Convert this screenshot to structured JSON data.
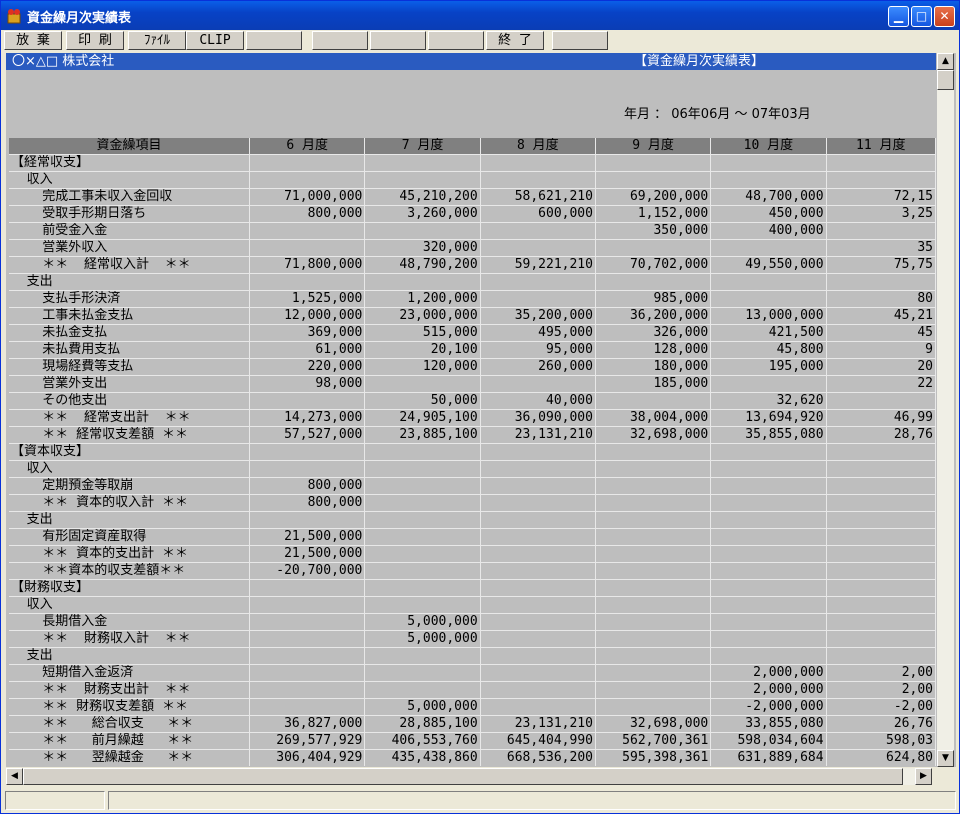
{
  "window": {
    "title": "資金繰月次実績表"
  },
  "toolbar": {
    "buttons": [
      "放 棄",
      "印 刷",
      "ﾌｧｲﾙ",
      "CLIP",
      "",
      "",
      "",
      "",
      "終 了",
      ""
    ]
  },
  "report": {
    "company": "〇×△□ 株式会社",
    "title": "【資金繰月次実績表】",
    "period": "年月 ： 06年06月 ～ 07年03月"
  },
  "table": {
    "columns": [
      "資金繰項目",
      "6 月度",
      "7 月度",
      "8 月度",
      "9 月度",
      "10 月度",
      "11 月度"
    ],
    "rows": [
      [
        "【経常収支】",
        "",
        "",
        "",
        "",
        "",
        ""
      ],
      [
        "  収入",
        "",
        "",
        "",
        "",
        "",
        ""
      ],
      [
        "    完成工事未収入金回収",
        "71,000,000",
        "45,210,200",
        "58,621,210",
        "69,200,000",
        "48,700,000",
        "72,15"
      ],
      [
        "    受取手形期日落ち",
        "800,000",
        "3,260,000",
        "600,000",
        "1,152,000",
        "450,000",
        "3,25"
      ],
      [
        "    前受金入金",
        "",
        "",
        "",
        "350,000",
        "400,000",
        ""
      ],
      [
        "    営業外収入",
        "",
        "320,000",
        "",
        "",
        "",
        "35"
      ],
      [
        "    ＊＊  経常収入計  ＊＊",
        "71,800,000",
        "48,790,200",
        "59,221,210",
        "70,702,000",
        "49,550,000",
        "75,75"
      ],
      [
        "  支出",
        "",
        "",
        "",
        "",
        "",
        ""
      ],
      [
        "    支払手形決済",
        "1,525,000",
        "1,200,000",
        "",
        "985,000",
        "",
        "80"
      ],
      [
        "    工事未払金支払",
        "12,000,000",
        "23,000,000",
        "35,200,000",
        "36,200,000",
        "13,000,000",
        "45,21"
      ],
      [
        "    未払金支払",
        "369,000",
        "515,000",
        "495,000",
        "326,000",
        "421,500",
        "45"
      ],
      [
        "    未払費用支払",
        "61,000",
        "20,100",
        "95,000",
        "128,000",
        "45,800",
        "9"
      ],
      [
        "    現場経費等支払",
        "220,000",
        "120,000",
        "260,000",
        "180,000",
        "195,000",
        "20"
      ],
      [
        "    営業外支出",
        "98,000",
        "",
        "",
        "185,000",
        "",
        "22"
      ],
      [
        "    その他支出",
        "",
        "50,000",
        "40,000",
        "",
        "32,620",
        ""
      ],
      [
        "    ＊＊  経常支出計  ＊＊",
        "14,273,000",
        "24,905,100",
        "36,090,000",
        "38,004,000",
        "13,694,920",
        "46,99"
      ],
      [
        "    ＊＊ 経常収支差額 ＊＊",
        "57,527,000",
        "23,885,100",
        "23,131,210",
        "32,698,000",
        "35,855,080",
        "28,76"
      ],
      [
        "【資本収支】",
        "",
        "",
        "",
        "",
        "",
        ""
      ],
      [
        "  収入",
        "",
        "",
        "",
        "",
        "",
        ""
      ],
      [
        "    定期預金等取崩",
        "800,000",
        "",
        "",
        "",
        "",
        ""
      ],
      [
        "    ＊＊ 資本的収入計 ＊＊",
        "800,000",
        "",
        "",
        "",
        "",
        ""
      ],
      [
        "  支出",
        "",
        "",
        "",
        "",
        "",
        ""
      ],
      [
        "    有形固定資産取得",
        "21,500,000",
        "",
        "",
        "",
        "",
        ""
      ],
      [
        "    ＊＊ 資本的支出計 ＊＊",
        "21,500,000",
        "",
        "",
        "",
        "",
        ""
      ],
      [
        "    ＊＊資本的収支差額＊＊",
        "-20,700,000",
        "",
        "",
        "",
        "",
        ""
      ],
      [
        "【財務収支】",
        "",
        "",
        "",
        "",
        "",
        ""
      ],
      [
        "  収入",
        "",
        "",
        "",
        "",
        "",
        ""
      ],
      [
        "    長期借入金",
        "",
        "5,000,000",
        "",
        "",
        "",
        ""
      ],
      [
        "    ＊＊  財務収入計  ＊＊",
        "",
        "5,000,000",
        "",
        "",
        "",
        ""
      ],
      [
        "  支出",
        "",
        "",
        "",
        "",
        "",
        ""
      ],
      [
        "    短期借入金返済",
        "",
        "",
        "",
        "",
        "2,000,000",
        "2,00"
      ],
      [
        "    ＊＊  財務支出計  ＊＊",
        "",
        "",
        "",
        "",
        "2,000,000",
        "2,00"
      ],
      [
        "    ＊＊ 財務収支差額 ＊＊",
        "",
        "5,000,000",
        "",
        "",
        "-2,000,000",
        "-2,00"
      ],
      [
        "    ＊＊   総合収支   ＊＊",
        "36,827,000",
        "28,885,100",
        "23,131,210",
        "32,698,000",
        "33,855,080",
        "26,76"
      ],
      [
        "    ＊＊   前月繰越   ＊＊",
        "269,577,929",
        "406,553,760",
        "645,404,990",
        "562,700,361",
        "598,034,604",
        "598,03"
      ],
      [
        "    ＊＊   翌繰越金   ＊＊",
        "306,404,929",
        "435,438,860",
        "668,536,200",
        "595,398,361",
        "631,889,684",
        "624,80"
      ]
    ]
  }
}
